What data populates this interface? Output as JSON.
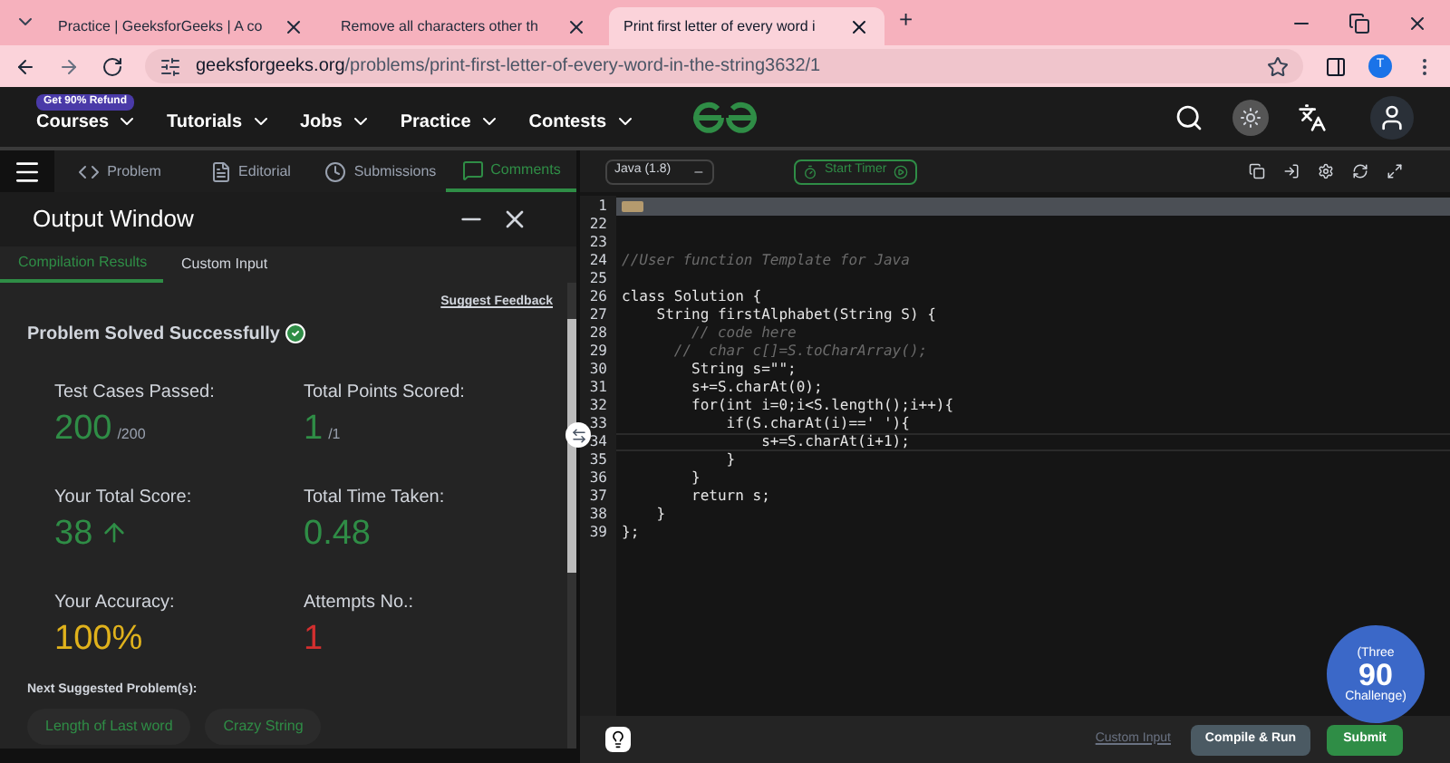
{
  "browser": {
    "tabs": [
      {
        "title": "Practice | GeeksforGeeks | A co",
        "selected": false
      },
      {
        "title": "Remove all characters other th",
        "selected": false
      },
      {
        "title": "Print first letter of every word i",
        "selected": true
      }
    ],
    "new_tab": "+",
    "url_host": "geeksforgeeks.org",
    "url_path": "/problems/print-first-letter-of-every-word-in-the-string3632/1",
    "profile": "T"
  },
  "nav": {
    "badge": "Get 90% Refund",
    "items": [
      "Courses",
      "Tutorials",
      "Jobs",
      "Practice",
      "Contests"
    ]
  },
  "problem_tabs": [
    {
      "label": "Problem",
      "selected": false
    },
    {
      "label": "Editorial",
      "selected": false
    },
    {
      "label": "Submissions",
      "selected": false
    },
    {
      "label": "Comments",
      "selected": true
    }
  ],
  "output": {
    "title": "Output Window",
    "tabs": [
      {
        "label": "Compilation Results",
        "selected": true
      },
      {
        "label": "Custom Input",
        "selected": false
      }
    ],
    "feedback": "Suggest Feedback",
    "status": "Problem Solved Successfully",
    "stats": [
      {
        "label": "Test Cases Passed:",
        "value": "200",
        "suffix": "/200",
        "color": "#2f8d46"
      },
      {
        "label": "Total Points Scored:",
        "value": "1",
        "suffix": "/1",
        "color": "#2f8d46"
      },
      {
        "label": "Your Total Score:",
        "value": "38",
        "arrow": true,
        "color": "#2f8d46"
      },
      {
        "label": "Total Time Taken:",
        "value": "0.48",
        "color": "#2f8d46"
      },
      {
        "label": "Your Accuracy:",
        "value": "100%",
        "color": "#e0b21c"
      },
      {
        "label": "Attempts No.:",
        "value": "1",
        "color": "#d32f2f"
      }
    ],
    "next_label": "Next Suggested Problem(s):",
    "next": [
      "Length of Last word",
      "Crazy String"
    ]
  },
  "editor": {
    "language": "Java (1.8)",
    "timer": "Start Timer",
    "lines": [
      {
        "n": "1",
        "kind": "folded"
      },
      {
        "n": "22",
        "kind": "code"
      },
      {
        "n": "23",
        "kind": "code"
      },
      {
        "n": "24",
        "kind": "comment",
        "text": "//User function Template for Java"
      },
      {
        "n": "25",
        "kind": "code"
      },
      {
        "n": "26",
        "kind": "code",
        "text": "class Solution {"
      },
      {
        "n": "27",
        "kind": "code",
        "text": "    String firstAlphabet(String S) {"
      },
      {
        "n": "28",
        "kind": "comment",
        "text": "        // code here"
      },
      {
        "n": "29",
        "kind": "comment",
        "text": "      //  char c[]=S.toCharArray();"
      },
      {
        "n": "30",
        "kind": "code",
        "text": "        String s=\"\";"
      },
      {
        "n": "31",
        "kind": "code",
        "text": "        s+=S.charAt(0);"
      },
      {
        "n": "32",
        "kind": "code",
        "text": "        for(int i=0;i<S.length();i++){"
      },
      {
        "n": "33",
        "kind": "code",
        "text": "            if(S.charAt(i)==' '){"
      },
      {
        "n": "34",
        "kind": "current",
        "text": "                s+=S.charAt(i+1);"
      },
      {
        "n": "35",
        "kind": "code",
        "text": "            }"
      },
      {
        "n": "36",
        "kind": "code",
        "text": "        }"
      },
      {
        "n": "37",
        "kind": "code",
        "text": "        return s;"
      },
      {
        "n": "38",
        "kind": "code",
        "text": "    }"
      },
      {
        "n": "39",
        "kind": "code",
        "text": "};"
      }
    ],
    "custom_input": "Custom Input",
    "compile": "Compile & Run",
    "submit": "Submit",
    "challenge": {
      "top": "(Three",
      "number": "90",
      "bottom": "Challenge)"
    }
  }
}
